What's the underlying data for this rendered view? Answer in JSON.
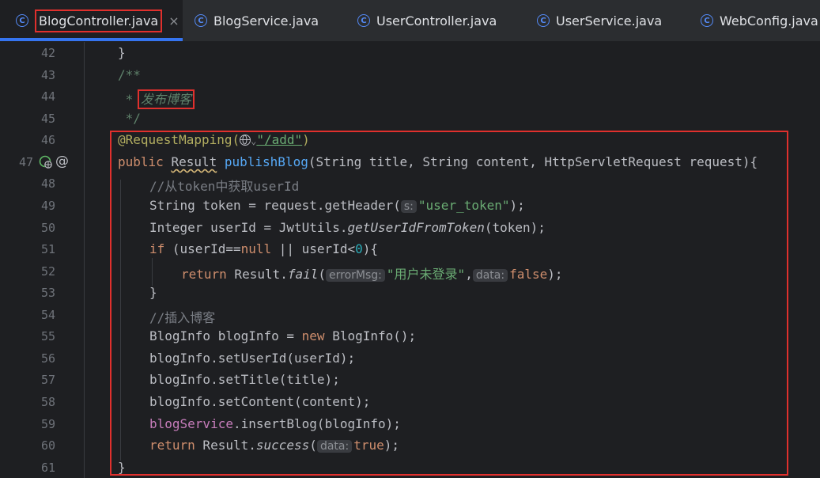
{
  "tabs": [
    {
      "label": "BlogController.java",
      "active": true,
      "close": "×"
    },
    {
      "label": "BlogService.java"
    },
    {
      "label": "UserController.java"
    },
    {
      "label": "UserService.java"
    },
    {
      "label": "WebConfig.java"
    }
  ],
  "tab_icon_glyph": "C",
  "gutter": {
    "line_numbers": [
      "42",
      "43",
      "44",
      "45",
      "46",
      "47",
      "48",
      "49",
      "50",
      "51",
      "52",
      "53",
      "54",
      "55",
      "56",
      "57",
      "58",
      "59",
      "60",
      "61"
    ],
    "at_glyph": "@"
  },
  "code": {
    "l42": "}",
    "l43": "/**",
    "l44_star": " * ",
    "l44_text": "发布博客",
    "l45": " */",
    "l46": {
      "annotation": "@RequestMapping(",
      "dropdown": "⌄",
      "path": "\"/add\"",
      "close": ")"
    },
    "l47": {
      "public": "public ",
      "type": "Result",
      "space": " ",
      "method": "publishBlog",
      "params": "(String title, String content, HttpServletRequest request){"
    },
    "l48": "//从token中获取userId",
    "l49": {
      "pre": "String token = request.getHeader(",
      "hint": "s:",
      "str": "\"user_token\"",
      "post": ");"
    },
    "l50": {
      "pre": "Integer userId = JwtUtils.",
      "method": "getUserIdFromToken",
      "post": "(token);"
    },
    "l51": {
      "if": "if",
      "a": " (userId==",
      "null": "null",
      "b": " || userId<",
      "zero": "0",
      "c": "){"
    },
    "l52": {
      "ret": "return",
      "a": " Result.",
      "method": "fail",
      "b": "(",
      "hint1": "errorMsg:",
      "str": "\"用户未登录\"",
      "comma": ",",
      "hint2": "data:",
      "false": "false",
      "c": ");"
    },
    "l53": "}",
    "l54": "//插入博客",
    "l55": {
      "a": "BlogInfo blogInfo = ",
      "new": "new",
      "b": " BlogInfo();"
    },
    "l56": "blogInfo.setUserId(userId);",
    "l57": "blogInfo.setTitle(title);",
    "l58": "blogInfo.setContent(content);",
    "l59": {
      "field": "blogService",
      "rest": ".insertBlog(blogInfo);"
    },
    "l60": {
      "ret": "return",
      "a": " Result.",
      "method": "success",
      "b": "(",
      "hint": "data:",
      "true": "true",
      "c": ");"
    },
    "l61": "}"
  },
  "colors": {
    "highlight_box": "#e0302d",
    "tab_accent": "#3574f0"
  }
}
